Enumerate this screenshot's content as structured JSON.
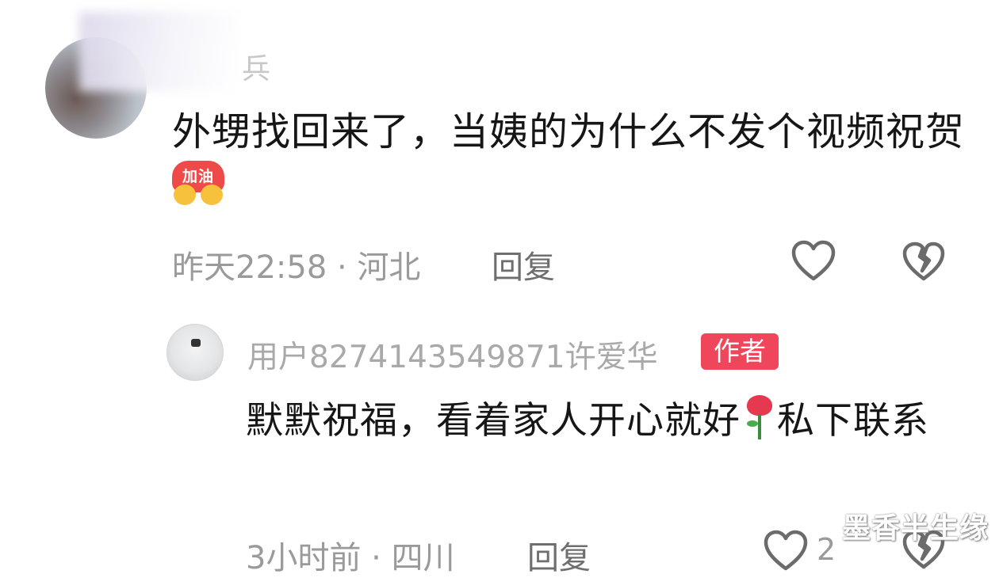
{
  "comment1": {
    "username": "兵",
    "text": "外甥找回来了，当姨的为什么不发个视频祝贺",
    "sticker_text": "加油",
    "time": "昨天22:58",
    "separator": "·",
    "location": "河北",
    "reply_label": "回复",
    "icons": {
      "like": "heart-outline-icon",
      "dislike": "broken-heart-icon"
    }
  },
  "comment2": {
    "username": "用户8274143549871许爱华",
    "badge": "作者",
    "text_before_emoji": "默默祝福，看着家人开心就好",
    "emoji": "rose-emoji",
    "text_after_emoji": "私下联系",
    "time": "3小时前",
    "separator": "·",
    "location": "四川",
    "reply_label": "回复",
    "like_count": "2",
    "icons": {
      "like": "heart-outline-icon",
      "dislike": "broken-heart-icon"
    }
  },
  "watermark": "墨香半生缘",
  "colors": {
    "badge": "#f0465b",
    "meta_text": "#9a9a9a",
    "body_text": "#161616"
  }
}
